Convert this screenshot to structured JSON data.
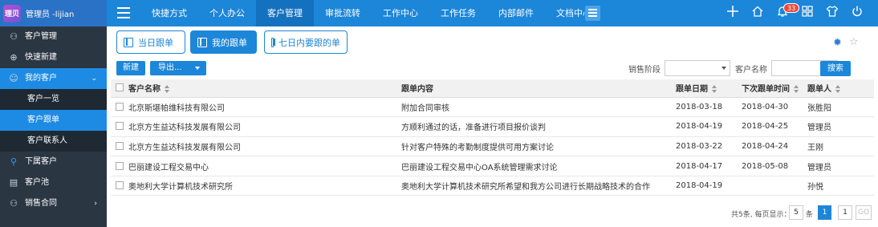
{
  "brand": {
    "logo_text": "理贝",
    "user_label": "管理员 -lijian"
  },
  "topnav": {
    "items": [
      "快捷方式",
      "个人办公",
      "客户管理",
      "审批流转",
      "工作中心",
      "工作任务",
      "内部邮件",
      "文档中心"
    ],
    "active": "客户管理",
    "badge_count": "33",
    "icons": [
      "plus-icon",
      "home-icon",
      "bell-icon",
      "grid-icon",
      "shirt-icon",
      "power-icon"
    ]
  },
  "sidebar": {
    "items": [
      {
        "label": "客户管理",
        "icon": "user-icon"
      },
      {
        "label": "快速新建",
        "icon": "plus-circle-icon"
      },
      {
        "label": "我的客户",
        "icon": "users-icon"
      },
      {
        "label": "下属客户",
        "icon": "person-icon"
      },
      {
        "label": "客户池",
        "icon": "clipboard-icon"
      },
      {
        "label": "销售合同",
        "icon": "contract-icon"
      }
    ],
    "subitems": [
      "客户一览",
      "客户跟单",
      "客户联系人"
    ],
    "active_sub": "客户跟单"
  },
  "tabs": [
    "当日跟单",
    "我的跟单",
    "七日内要跟的单"
  ],
  "active_tab": "我的跟单",
  "toolbar": {
    "new_label": "新建",
    "export_label": "导出...",
    "stage_label": "销售阶段",
    "stage_value": "",
    "customer_label": "客户名称",
    "customer_value": "",
    "search_label": "搜索"
  },
  "table": {
    "headers": [
      "客户名称",
      "跟单内容",
      "跟单日期",
      "下次跟单时间",
      "跟单人"
    ],
    "rows": [
      [
        "北京斯堪帕维科技有限公司",
        "附加合同审核",
        "2018-03-18",
        "2018-04-30",
        "张胜阳"
      ],
      [
        "北京方生益达科技发展有限公司",
        "方顺利通过的话，准备进行项目报价谈判",
        "2018-04-19",
        "2018-04-25",
        "管理员"
      ],
      [
        "北京方生益达科技发展有限公司",
        "针对客户特殊的考勤制度提供可用方案讨论",
        "2018-03-22",
        "2018-04-24",
        "王刚"
      ],
      [
        "巴丽建设工程交易中心",
        "巴丽建设工程交易中心OA系统管理需求讨论",
        "2018-04-17",
        "2018-05-08",
        "管理员"
      ],
      [
        "奥地利大学计算机技术研究所",
        "奥地利大学计算机技术研究所希望和我方公司进行长期战略技术的合作",
        "2018-04-19",
        "",
        "孙悦"
      ]
    ]
  },
  "pager": {
    "summary": "共5条, 每页显示：",
    "page_size": "5",
    "unit": "条",
    "current_page": "1",
    "goto_value": "1",
    "go_label": "GO"
  }
}
